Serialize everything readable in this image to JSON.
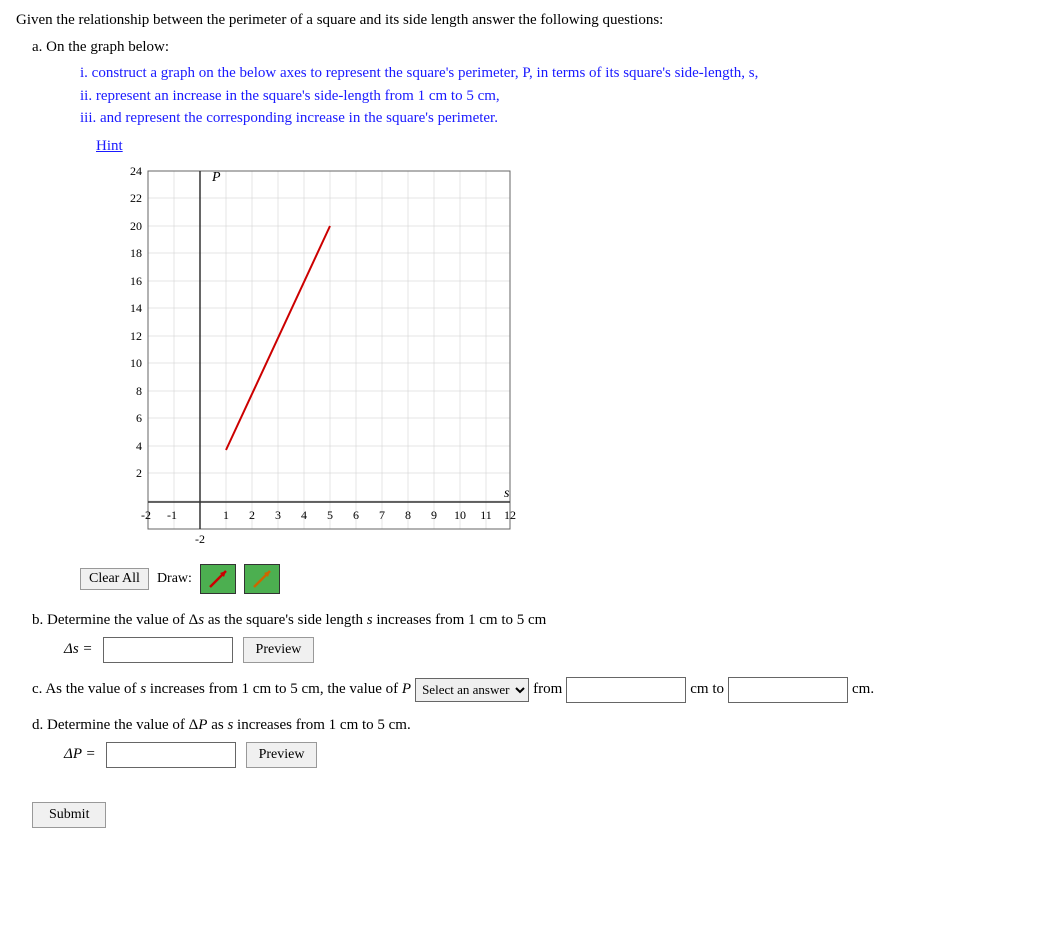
{
  "intro": "Given the relationship between the perimeter of a square and its side length answer the following questions:",
  "part_a": {
    "label": "a. On the graph below:",
    "sub_i": "i. construct a graph on the below axes to represent the square's perimeter, P, in terms of its square's side-length, s,",
    "sub_ii": "ii. represent an increase in the square's side-length from 1 cm to 5 cm,",
    "sub_iii": "iii. and represent the corresponding increase in the square's perimeter.",
    "hint": "Hint",
    "y_label": "P",
    "x_label": "s",
    "y_values": [
      24,
      22,
      20,
      18,
      16,
      14,
      12,
      10,
      8,
      6,
      4,
      2
    ],
    "x_values": [
      -2,
      -1,
      1,
      2,
      3,
      4,
      5,
      6,
      7,
      8,
      9,
      10,
      11,
      12
    ],
    "neg_values": [
      -2
    ]
  },
  "controls": {
    "clear_all": "Clear All",
    "draw_label": "Draw:"
  },
  "part_b": {
    "label": "b. Determine the value of Δs as the square's side length s increases from 1 cm to 5 cm",
    "delta_s_label": "Δs =",
    "preview": "Preview"
  },
  "part_c": {
    "label_start": "c. As the value of s increases from 1 cm to 5 cm, the value of P",
    "select_placeholder": "Select an answer",
    "label_from": "from",
    "cm_to": "cm to",
    "cm_end": "cm."
  },
  "part_d": {
    "label": "d. Determine the value of ΔP as s increases from 1 cm to 5 cm.",
    "delta_p_label": "ΔP =",
    "preview": "Preview"
  },
  "submit": "Submit"
}
